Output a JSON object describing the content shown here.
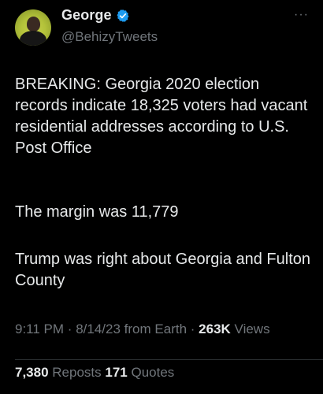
{
  "author": {
    "display_name": "George",
    "handle": "@BehizyTweets",
    "verified": true
  },
  "post": {
    "paragraphs": [
      "BREAKING: Georgia 2020 election records indicate 18,325 voters had vacant residential addresses according to U.S. Post Office",
      "The margin was 11,779",
      "Trump was right about Georgia and Fulton County"
    ],
    "time": "9:11 PM",
    "separator": "·",
    "date": "8/14/23",
    "source": "from Earth",
    "views_count": "263K",
    "views_label": "Views"
  },
  "engagement": {
    "reposts_count": "7,380",
    "reposts_label": "Reposts",
    "quotes_count": "171",
    "quotes_label": "Quotes"
  },
  "menu": {
    "more_label": "···"
  },
  "colors": {
    "background": "#000000",
    "primary_text": "#e7e9ea",
    "secondary_text": "#71767b",
    "verified_badge": "#1d9bf0",
    "divider": "#2f3336"
  },
  "icons": {
    "verified": "verified-badge-icon",
    "more": "more-options-icon"
  }
}
